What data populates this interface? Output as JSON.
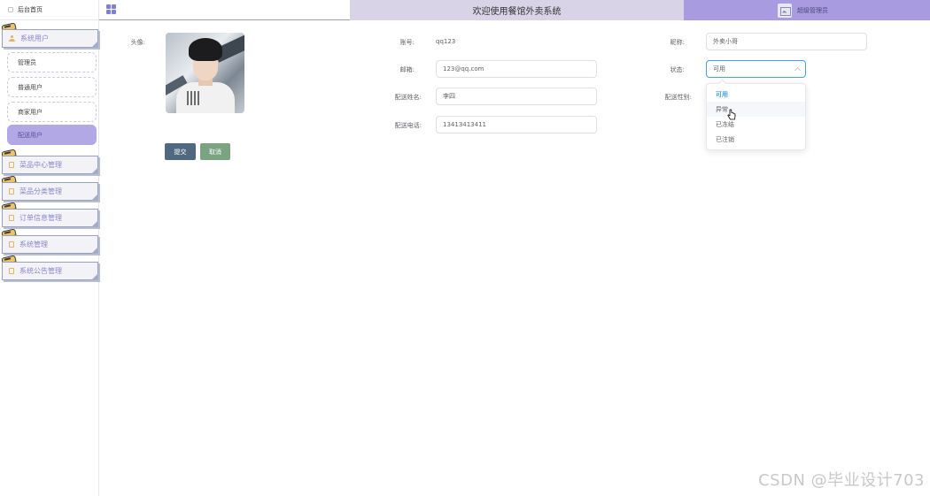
{
  "sidebar": {
    "home": "后台首页",
    "groups": [
      {
        "label": "系统用户",
        "icon": "user-icon"
      },
      {
        "label": "菜品中心管理",
        "icon": "doc-icon"
      },
      {
        "label": "菜品分类管理",
        "icon": "doc-icon"
      },
      {
        "label": "订单信息管理",
        "icon": "doc-icon"
      },
      {
        "label": "系统管理",
        "icon": "doc-icon"
      },
      {
        "label": "系统公告管理",
        "icon": "doc-icon"
      }
    ],
    "sub_items": [
      "管理员",
      "普通用户",
      "商家用户",
      "配送用户"
    ],
    "active_sub_item": "配送用户"
  },
  "header": {
    "title": "欢迎使用餐馆外卖系统",
    "user": "超级管理员"
  },
  "form": {
    "avatar_label": "头像:",
    "account_label": "账号:",
    "account_value": "qq123",
    "nickname_label": "昵称:",
    "nickname_value": "外卖小哥",
    "email_label": "邮箱:",
    "email_value": "123@qq.com",
    "status_label": "状态:",
    "status_value": "可用",
    "delivery_name_label": "配送姓名:",
    "delivery_name_value": "李四",
    "delivery_gender_label": "配送性别:",
    "delivery_phone_label": "配送电话:",
    "delivery_phone_value": "13413413411",
    "submit_label": "提交",
    "cancel_label": "取消"
  },
  "status_dropdown": {
    "options": [
      "可用",
      "异常",
      "已冻结",
      "已注销"
    ],
    "selected": "可用",
    "hovered": "异常"
  },
  "watermark": "CSDN @毕业设计703",
  "colors": {
    "header_center": "#d9d3e8",
    "header_right": "#a99be0",
    "active_menu": "#b3a8e6",
    "submit_button": "#4f6a80",
    "cancel_button": "#7aa382",
    "focus_border": "#409eff"
  }
}
